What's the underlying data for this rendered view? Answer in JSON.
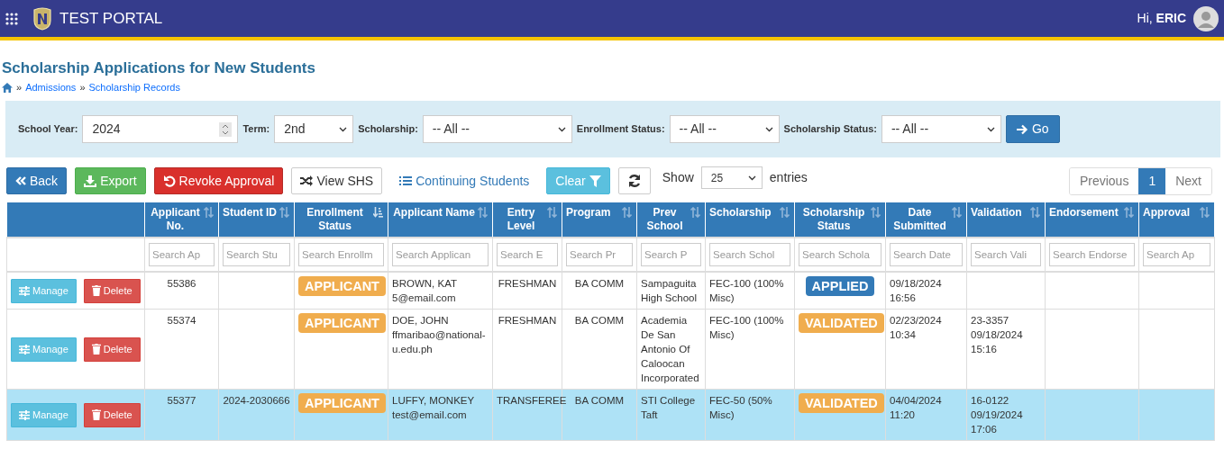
{
  "navbar": {
    "brand": "TEST PORTAL",
    "greeting": "Hi, **ERIC**"
  },
  "page": {
    "title": "Scholarship Applications for New Students",
    "breadcrumbs": [
      {
        "separator": "»",
        "label": "Admissions"
      },
      {
        "separator": "»",
        "label": "Scholarship Records"
      }
    ]
  },
  "filters": [
    {
      "label": "School Year:",
      "kind": "number",
      "value": "2024"
    },
    {
      "label": "Term:",
      "kind": "select",
      "value": "2nd"
    },
    {
      "label": "Scholarship:",
      "kind": "select",
      "value": "-- All --"
    },
    {
      "label": "Enrollment Status:",
      "kind": "select",
      "value": "-- All --"
    },
    {
      "label": "Scholarship Status:",
      "kind": "select",
      "value": "-- All --"
    }
  ],
  "go_button": "Go",
  "toolbar": [
    "Back",
    "Export",
    "Revoke Approval",
    "View SHS",
    "Continuing Students",
    "Clear"
  ],
  "length": {
    "before": "Show",
    "value": "25",
    "after": "entries"
  },
  "pagination": {
    "previous": "Previous",
    "pages": [
      {
        "label": "1",
        "selected": true
      }
    ],
    "next": "Next"
  },
  "table": {
    "columns": [
      {
        "label": "Applicant No.",
        "sorted": false,
        "placeholder": "Search Ap"
      },
      {
        "label": "Student ID",
        "sorted": false,
        "placeholder": "Search Stu"
      },
      {
        "label": "Enrollment Status",
        "sorted": true,
        "placeholder": "Search Enrollm"
      },
      {
        "label": "Applicant Name",
        "sorted": false,
        "placeholder": "Search Applican"
      },
      {
        "label": "Entry Level",
        "sorted": false,
        "placeholder": "Search E"
      },
      {
        "label": "Program",
        "sorted": false,
        "placeholder": "Search Pr"
      },
      {
        "label": "Prev School",
        "sorted": false,
        "placeholder": "Search P"
      },
      {
        "label": "Scholarship",
        "sorted": false,
        "placeholder": "Search Schol"
      },
      {
        "label": "Scholarship Status",
        "sorted": false,
        "placeholder": "Search Schola"
      },
      {
        "label": "Date Submitted",
        "sorted": false,
        "placeholder": "Search Date"
      },
      {
        "label": "Validation",
        "sorted": false,
        "placeholder": "Search Vali"
      },
      {
        "label": "Endorsement",
        "sorted": false,
        "placeholder": "Search Endorse"
      },
      {
        "label": "Approval",
        "sorted": false,
        "placeholder": "Search Ap"
      }
    ],
    "rows": [
      {
        "selected": false,
        "actions": [
          "Manage",
          "Delete"
        ],
        "cells": [
          {
            "kind": "text",
            "text": "55386"
          },
          {
            "kind": "empty"
          },
          {
            "kind": "badge",
            "text": "APPLICANT",
            "color": "#f0ad4e"
          },
          {
            "kind": "lines",
            "lines": [
              "BROWN, KAT",
              "5@email.com"
            ]
          },
          {
            "kind": "text",
            "text": "FRESHMAN"
          },
          {
            "kind": "text",
            "text": "BA COMM"
          },
          {
            "kind": "text",
            "text": "Sampaguita High School"
          },
          {
            "kind": "text",
            "text": "FEC-100 (100% Misc)"
          },
          {
            "kind": "badge",
            "text": "APPLIED",
            "color": "#337ab7"
          },
          {
            "kind": "lines",
            "lines": [
              "09/18/2024",
              "16:56"
            ]
          },
          {
            "kind": "empty"
          },
          {
            "kind": "empty"
          },
          {
            "kind": "empty"
          }
        ]
      },
      {
        "selected": false,
        "actions": [
          "Manage",
          "Delete"
        ],
        "cells": [
          {
            "kind": "text",
            "text": "55374"
          },
          {
            "kind": "empty"
          },
          {
            "kind": "badge",
            "text": "APPLICANT",
            "color": "#f0ad4e"
          },
          {
            "kind": "lines",
            "lines": [
              "DOE, JOHN",
              "ffmaribao@national-u.edu.ph"
            ]
          },
          {
            "kind": "text",
            "text": "FRESHMAN"
          },
          {
            "kind": "text",
            "text": "BA COMM"
          },
          {
            "kind": "text",
            "text": "Academia De San Antonio Of Caloocan Incorporated"
          },
          {
            "kind": "text",
            "text": "FEC-100 (100% Misc)"
          },
          {
            "kind": "badge",
            "text": "VALIDATED",
            "color": "#f0ad4e"
          },
          {
            "kind": "lines",
            "lines": [
              "02/23/2024",
              "10:34"
            ]
          },
          {
            "kind": "lines",
            "lines": [
              "23-3357",
              "09/18/2024",
              "15:16"
            ]
          },
          {
            "kind": "empty"
          },
          {
            "kind": "empty"
          }
        ]
      },
      {
        "selected": true,
        "actions": [
          "Manage",
          "Delete"
        ],
        "cells": [
          {
            "kind": "text",
            "text": "55377"
          },
          {
            "kind": "text",
            "text": "2024-2030666"
          },
          {
            "kind": "badge",
            "text": "APPLICANT",
            "color": "#f0ad4e"
          },
          {
            "kind": "lines",
            "lines": [
              "LUFFY, MONKEY",
              "test@email.com"
            ]
          },
          {
            "kind": "text",
            "text": "TRANSFEREE"
          },
          {
            "kind": "text",
            "text": "BA COMM"
          },
          {
            "kind": "text",
            "text": "STI College Taft"
          },
          {
            "kind": "text",
            "text": "FEC-50 (50% Misc)"
          },
          {
            "kind": "badge",
            "text": "VALIDATED",
            "color": "#f0ad4e"
          },
          {
            "kind": "lines",
            "lines": [
              "04/04/2024",
              "11:20"
            ]
          },
          {
            "kind": "lines",
            "lines": [
              "16-0122",
              "09/19/2024",
              "17:06"
            ]
          },
          {
            "kind": "empty"
          },
          {
            "kind": "empty"
          }
        ]
      }
    ]
  }
}
